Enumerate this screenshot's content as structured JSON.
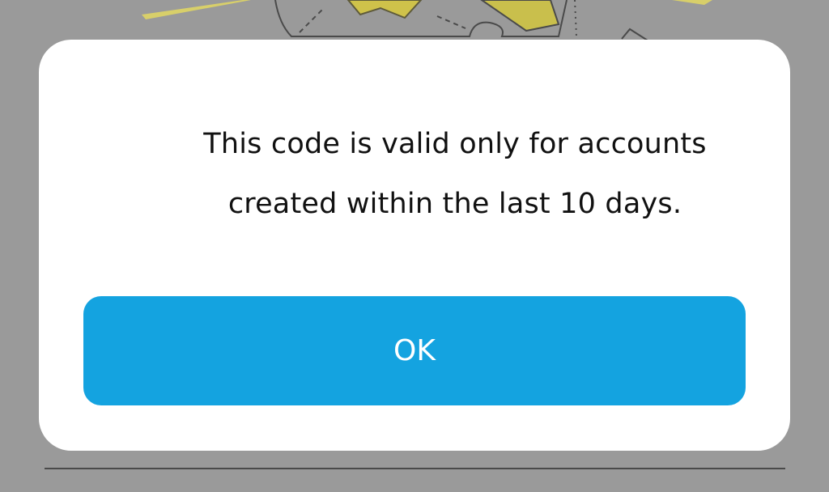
{
  "dialog": {
    "message": "This code is valid only for accounts created within the last 10 days.",
    "ok_label": "OK"
  },
  "colors": {
    "overlay": "#9a9a9a",
    "dialog_background": "#ffffff",
    "button_background": "#14a3e0",
    "button_text": "#ffffff",
    "message_text": "#111111"
  }
}
